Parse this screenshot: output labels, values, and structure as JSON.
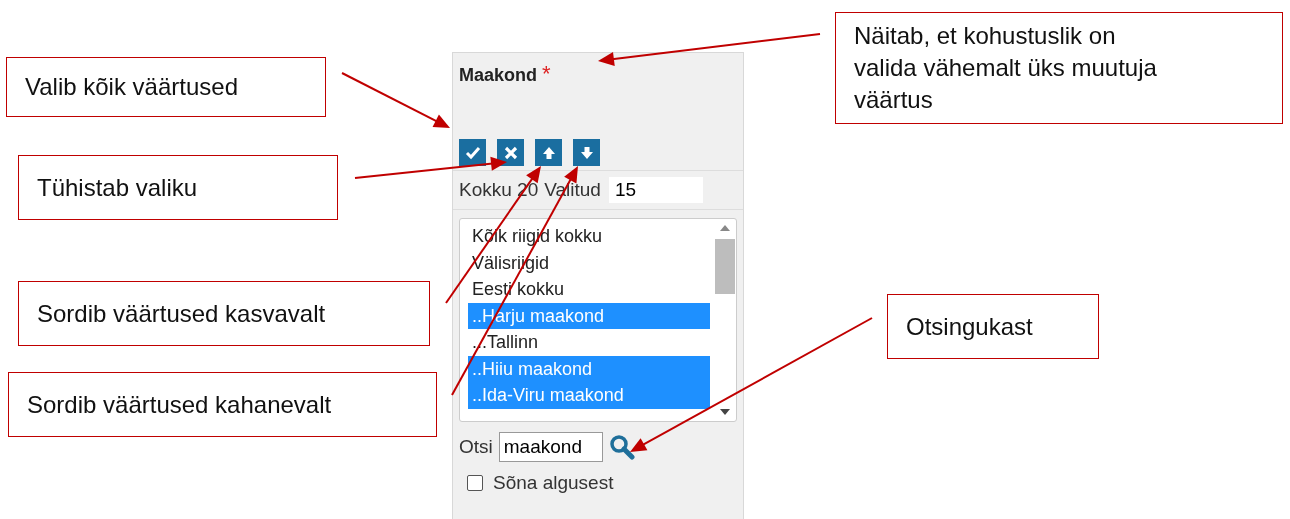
{
  "panel": {
    "title": "Maakond",
    "required_mark": "*",
    "toolbar": [
      {
        "kind": "check"
      },
      {
        "kind": "clear"
      },
      {
        "kind": "up"
      },
      {
        "kind": "down"
      }
    ],
    "total_label": "Kokku 20",
    "selected_label": "Valitud",
    "selected_count": "15",
    "items": [
      {
        "label": "Kõik riigid kokku",
        "selected": false
      },
      {
        "label": "Välisriigid",
        "selected": false
      },
      {
        "label": "Eesti kokku",
        "selected": false
      },
      {
        "label": "..Harju maakond",
        "selected": true
      },
      {
        "label": "...Tallinn",
        "selected": false
      },
      {
        "label": "..Hiiu maakond",
        "selected": true
      },
      {
        "label": "..Ida-Viru maakond",
        "selected": true
      }
    ],
    "search_label": "Otsi",
    "search_value": "maakond",
    "word_start": {
      "label": "Sõna algusest",
      "checked": false
    }
  },
  "callouts": [
    {
      "text": "Valib kõik väärtused"
    },
    {
      "text": "Tühistab valiku"
    },
    {
      "text": "Sordib väärtused kasvavalt"
    },
    {
      "text": "Sordib väärtused kahanevalt"
    },
    {
      "text": "Näitab, et kohustuslik on valida vähemalt üks muutuja väärtus"
    },
    {
      "text": "Otsingukast"
    }
  ]
}
